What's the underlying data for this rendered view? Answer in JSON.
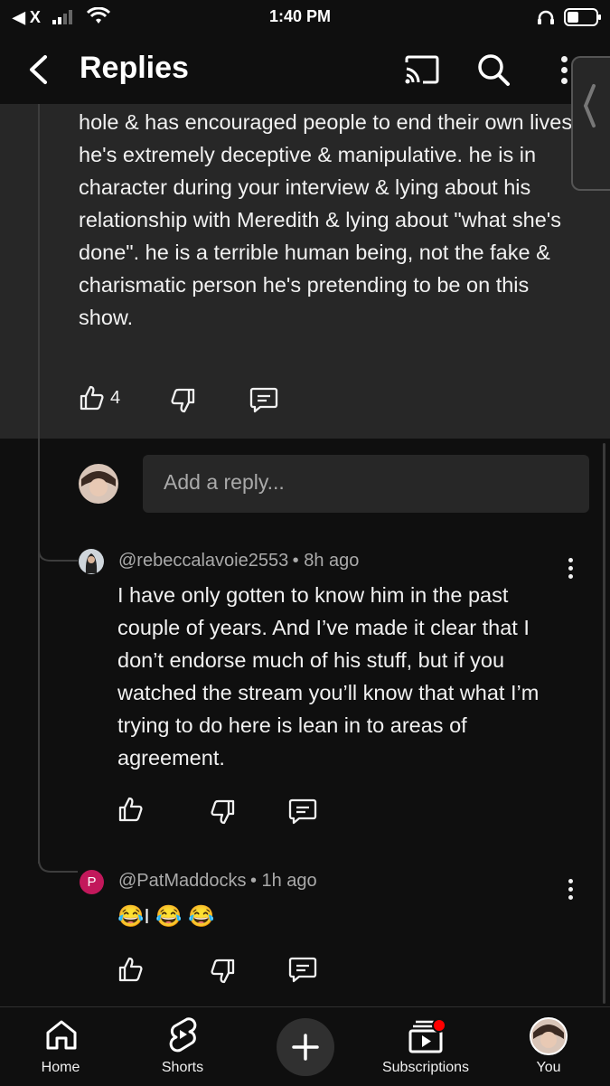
{
  "status_bar": {
    "back_app": "X",
    "time": "1:40 PM"
  },
  "header": {
    "title": "Replies"
  },
  "parent_comment": {
    "text": "hole & has encouraged people to end their own lives. he's extremely deceptive & manipulative. he is in character during your interview & lying about his relationship with Meredith & lying about \"what she's done\". he is a terrible human being, not the fake & charismatic person he's pretending to be on this show.",
    "like_count": "4"
  },
  "reply_input": {
    "placeholder": "Add a reply..."
  },
  "replies": [
    {
      "handle": "@rebeccalavoie2553",
      "time": "8h ago",
      "text": "I have only gotten to know him in the past couple of years. And I’ve made it clear that I don’t endorse much of his stuff, but if you watched the stream you’ll know that what I’m trying to do here is lean in to areas of agreement."
    },
    {
      "handle": "@PatMaddocks",
      "time": "1h ago",
      "avatar_letter": "P",
      "text": "😂I 😂 😂"
    }
  ],
  "bottom_nav": [
    {
      "label": "Home"
    },
    {
      "label": "Shorts"
    },
    {
      "label": "Subscriptions"
    },
    {
      "label": "You"
    }
  ],
  "colors": {
    "background": "#0f0f0f",
    "panel": "#272727",
    "secondary_text": "#aaaaaa",
    "notification": "#ff0000",
    "avatar_p": "#c2185b"
  }
}
